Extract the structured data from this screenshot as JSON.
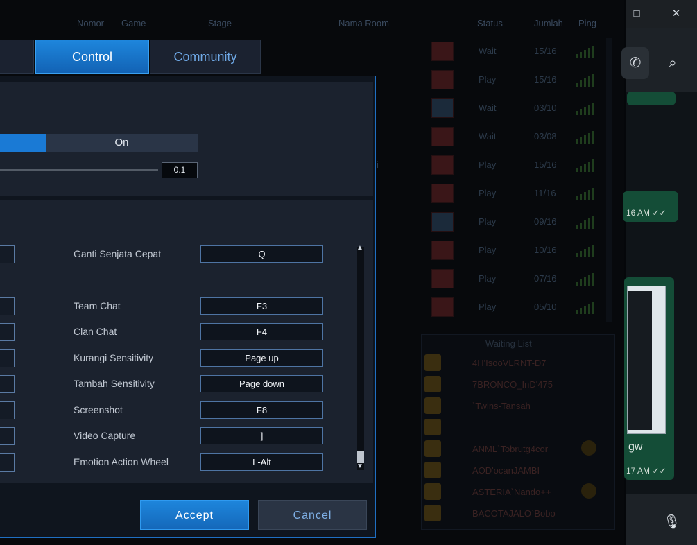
{
  "background": {
    "columns": [
      "Nomor",
      "Game",
      "Stage",
      "Nama Room",
      "Status",
      "Jumlah",
      "Ping"
    ],
    "rooms": [
      {
        "status": "Wait",
        "count": "15/16",
        "thumb": "red"
      },
      {
        "status": "Play",
        "count": "15/16",
        "thumb": "red"
      },
      {
        "status": "Wait",
        "count": "03/10",
        "thumb": "blue"
      },
      {
        "status": "Wait",
        "count": "03/08",
        "thumb": "red"
      },
      {
        "status": "Play",
        "count": "15/16",
        "thumb": "red"
      },
      {
        "status": "Play",
        "count": "11/16",
        "thumb": "red"
      },
      {
        "status": "Play",
        "count": "09/16",
        "thumb": "blue"
      },
      {
        "status": "Play",
        "count": "10/16",
        "thumb": "red"
      },
      {
        "status": "Play",
        "count": "07/16",
        "thumb": "red"
      },
      {
        "status": "Play",
        "count": "05/10",
        "thumb": "red"
      }
    ],
    "room_suffix": "i",
    "waiting_title": "Waiting List",
    "waiting": [
      "4H'IsooVLRNT-D7",
      "7BRONCO_InD'475",
      "`Twins-Tansah",
      "",
      "ANML`Tobrutg4cor",
      "AOD'ocanJAMBI",
      "ASTERIA`Nando++",
      "BACOTAJALO`Bobo"
    ]
  },
  "whatsapp": {
    "minimize_icon": "□",
    "close_icon": "✕",
    "call_icon": "✆",
    "search_icon": "⌕",
    "time_1": "16 AM ✓✓",
    "message_text": "gw",
    "time_2": "17 AM ✓✓",
    "mic_icon": "🎙"
  },
  "dialog": {
    "tabs": {
      "control": "Control",
      "community": "Community"
    },
    "toggle_on_label": "On",
    "slider_value": "0.1",
    "keybinds": [
      {
        "label": "Ganti Senjata Cepat",
        "key": "Q"
      },
      {
        "label": "Team Chat",
        "key": "F3"
      },
      {
        "label": "Clan Chat",
        "key": "F4"
      },
      {
        "label": "Kurangi Sensitivity",
        "key": "Page up"
      },
      {
        "label": "Tambah Sensitivity",
        "key": "Page down"
      },
      {
        "label": "Screenshot",
        "key": "F8"
      },
      {
        "label": "Video Capture",
        "key": "]"
      },
      {
        "label": "Emotion Action Wheel",
        "key": "L-Alt"
      }
    ],
    "scroll_up_icon": "▲",
    "scroll_down_icon": "▼",
    "accept_label": "Accept",
    "cancel_label": "Cancel"
  }
}
